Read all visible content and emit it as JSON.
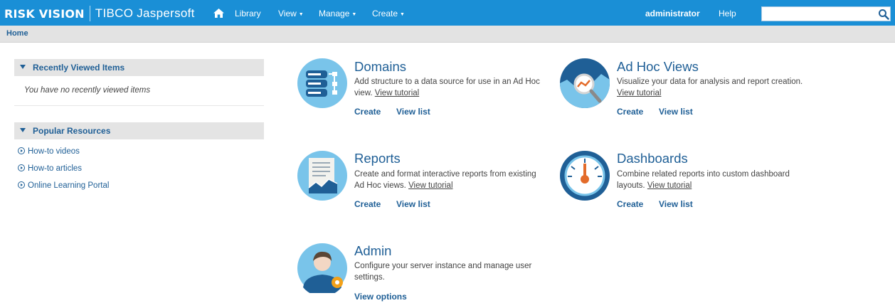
{
  "topbar": {
    "brand_primary": "RISK VISION",
    "brand_secondary": "TIBCO Jaspersoft",
    "nav": [
      {
        "label": "Library"
      },
      {
        "label": "View"
      },
      {
        "label": "Manage"
      },
      {
        "label": "Create"
      }
    ],
    "user": "administrator",
    "help": "Help",
    "search_value": "",
    "bg_color": "#1a8fd6"
  },
  "breadcrumb": {
    "label": "Home"
  },
  "sidebar": {
    "recent": {
      "title": "Recently Viewed Items",
      "empty_message": "You have no recently viewed items"
    },
    "popular": {
      "title": "Popular Resources",
      "links": [
        {
          "label": "How-to videos"
        },
        {
          "label": "How-to articles"
        },
        {
          "label": "Online Learning Portal"
        }
      ]
    }
  },
  "cards": {
    "domains": {
      "title": "Domains",
      "desc": "Add structure to a data source for use in an Ad Hoc view.",
      "tutorial": "View tutorial",
      "create": "Create",
      "view_list": "View list",
      "icon": "database-icon"
    },
    "adhoc": {
      "title": "Ad Hoc Views",
      "desc": "Visualize your data for analysis and report creation.",
      "tutorial": "View tutorial",
      "create": "Create",
      "view_list": "View list",
      "icon": "magnifier-chart-icon"
    },
    "reports": {
      "title": "Reports",
      "desc": "Create and format interactive reports from existing Ad Hoc views.",
      "tutorial": "View tutorial",
      "create": "Create",
      "view_list": "View list",
      "icon": "report-icon"
    },
    "dashboards": {
      "title": "Dashboards",
      "desc": "Combine related reports into custom dashboard layouts.",
      "tutorial": "View tutorial",
      "create": "Create",
      "view_list": "View list",
      "icon": "gauge-icon"
    },
    "admin": {
      "title": "Admin",
      "desc": "Configure your server instance and manage user settings.",
      "view_options": "View options",
      "icon": "admin-user-icon"
    }
  }
}
